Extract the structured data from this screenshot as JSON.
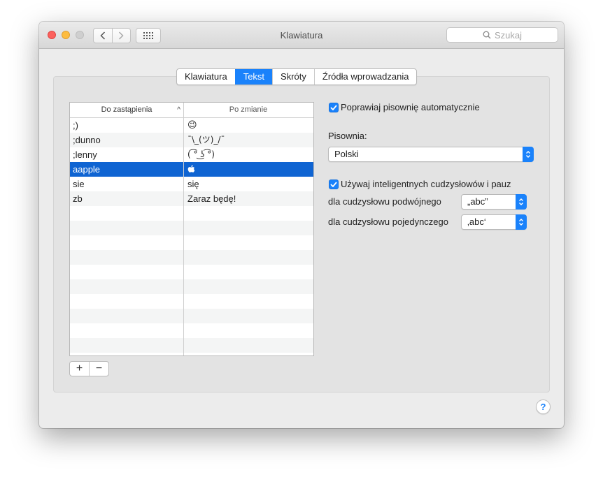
{
  "window": {
    "title": "Klawiatura"
  },
  "search": {
    "placeholder": "Szukaj"
  },
  "tabs": [
    {
      "label": "Klawiatura"
    },
    {
      "label": "Tekst"
    },
    {
      "label": "Skróty"
    },
    {
      "label": "Źródła wprowadzania"
    }
  ],
  "table": {
    "headers": {
      "replace": "Do zastąpienia",
      "with": "Po zmianie"
    },
    "rows": [
      {
        "replace": ";)",
        "with": "😉"
      },
      {
        "replace": ";dunno",
        "with": "¯\\_(ツ)_/¯"
      },
      {
        "replace": ";lenny",
        "with": "( ͡° ͜ʖ ͡°)"
      },
      {
        "replace": "aapple",
        "with": ""
      },
      {
        "replace": "sie",
        "with": "się"
      },
      {
        "replace": "zb",
        "with": "Zaraz będę!"
      }
    ]
  },
  "buttons": {
    "add": "+",
    "remove": "−",
    "help": "?"
  },
  "options": {
    "spelling_correct": "Poprawiaj pisownię automatycznie",
    "spelling_label": "Pisownia:",
    "spelling_value": "Polski",
    "smart_quotes": "Używaj inteligentnych cudzysłowów i pauz",
    "double_label": "dla cudzysłowu podwójnego",
    "double_value": "„abc”",
    "single_label": "dla cudzysłowu pojedynczego",
    "single_value": "‚abc‘"
  },
  "colors": {
    "accent": "#1a82fb",
    "selection": "#0f64d2"
  }
}
